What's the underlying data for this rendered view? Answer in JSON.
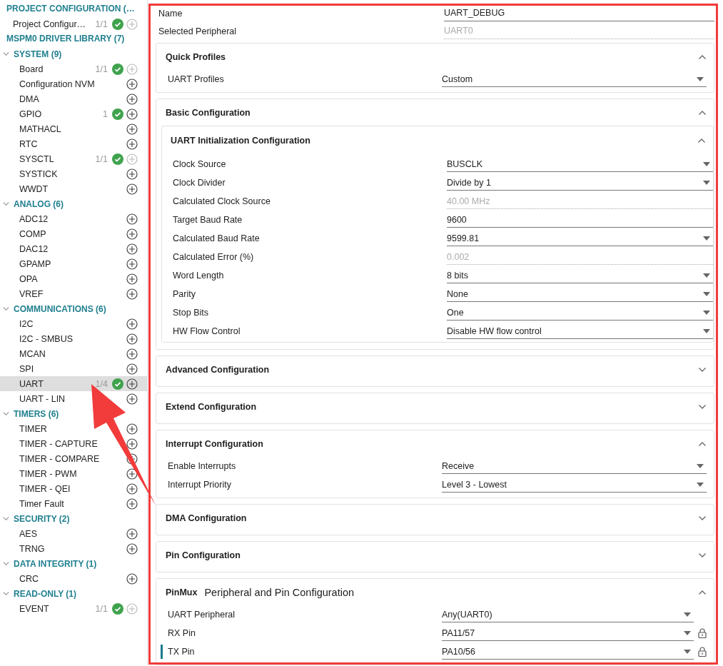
{
  "sidebar": {
    "groups": [
      {
        "label": "PROJECT CONFIGURATION (…",
        "items": [
          {
            "label": "Project Configur…",
            "count": "1/1",
            "configured": true,
            "can_add": false,
            "selected": false
          }
        ]
      },
      {
        "label": "MSPM0 DRIVER LIBRARY (7)",
        "categories": [
          {
            "label": "SYSTEM (9)",
            "expanded": true,
            "items": [
              {
                "label": "Board",
                "count": "1/1",
                "configured": true,
                "can_add": false,
                "selected": false
              },
              {
                "label": "Configuration NVM",
                "configured": false,
                "can_add": true,
                "selected": false
              },
              {
                "label": "DMA",
                "configured": false,
                "can_add": true,
                "selected": false
              },
              {
                "label": "GPIO",
                "count": "1",
                "configured": true,
                "can_add": true,
                "selected": false
              },
              {
                "label": "MATHACL",
                "configured": false,
                "can_add": true,
                "selected": false
              },
              {
                "label": "RTC",
                "configured": false,
                "can_add": true,
                "selected": false
              },
              {
                "label": "SYSCTL",
                "count": "1/1",
                "configured": true,
                "can_add": false,
                "selected": false
              },
              {
                "label": "SYSTICK",
                "configured": false,
                "can_add": true,
                "selected": false
              },
              {
                "label": "WWDT",
                "configured": false,
                "can_add": true,
                "selected": false
              }
            ]
          },
          {
            "label": "ANALOG (6)",
            "expanded": true,
            "items": [
              {
                "label": "ADC12",
                "configured": false,
                "can_add": true,
                "selected": false
              },
              {
                "label": "COMP",
                "configured": false,
                "can_add": true,
                "selected": false
              },
              {
                "label": "DAC12",
                "configured": false,
                "can_add": true,
                "selected": false
              },
              {
                "label": "GPAMP",
                "configured": false,
                "can_add": true,
                "selected": false
              },
              {
                "label": "OPA",
                "configured": false,
                "can_add": true,
                "selected": false
              },
              {
                "label": "VREF",
                "configured": false,
                "can_add": true,
                "selected": false
              }
            ]
          },
          {
            "label": "COMMUNICATIONS (6)",
            "expanded": true,
            "items": [
              {
                "label": "I2C",
                "configured": false,
                "can_add": true,
                "selected": false
              },
              {
                "label": "I2C - SMBUS",
                "configured": false,
                "can_add": true,
                "selected": false
              },
              {
                "label": "MCAN",
                "configured": false,
                "can_add": true,
                "selected": false
              },
              {
                "label": "SPI",
                "configured": false,
                "can_add": true,
                "selected": false
              },
              {
                "label": "UART",
                "count": "1/4",
                "configured": true,
                "can_add": true,
                "selected": true
              },
              {
                "label": "UART - LIN",
                "configured": false,
                "can_add": true,
                "selected": false
              }
            ]
          },
          {
            "label": "TIMERS (6)",
            "expanded": true,
            "items": [
              {
                "label": "TIMER",
                "configured": false,
                "can_add": true,
                "selected": false
              },
              {
                "label": "TIMER - CAPTURE",
                "configured": false,
                "can_add": true,
                "selected": false
              },
              {
                "label": "TIMER - COMPARE",
                "configured": false,
                "can_add": true,
                "selected": false
              },
              {
                "label": "TIMER - PWM",
                "configured": false,
                "can_add": true,
                "selected": false
              },
              {
                "label": "TIMER - QEI",
                "configured": false,
                "can_add": true,
                "selected": false
              },
              {
                "label": "Timer Fault",
                "configured": false,
                "can_add": true,
                "selected": false
              }
            ]
          },
          {
            "label": "SECURITY (2)",
            "expanded": true,
            "items": [
              {
                "label": "AES",
                "configured": false,
                "can_add": true,
                "selected": false
              },
              {
                "label": "TRNG",
                "configured": false,
                "can_add": true,
                "selected": false
              }
            ]
          },
          {
            "label": "DATA INTEGRITY (1)",
            "expanded": true,
            "items": [
              {
                "label": "CRC",
                "configured": false,
                "can_add": true,
                "selected": false
              }
            ]
          },
          {
            "label": "READ-ONLY (1)",
            "expanded": true,
            "items": [
              {
                "label": "EVENT",
                "count": "1/1",
                "configured": true,
                "can_add": false,
                "selected": false
              }
            ]
          }
        ]
      }
    ]
  },
  "fields": [
    {
      "label": "Name",
      "kind": "text",
      "value": "UART_DEBUG"
    },
    {
      "label": "Selected Peripheral",
      "kind": "readonly",
      "value": "UART0"
    }
  ],
  "sections": [
    {
      "title": "Quick Profiles",
      "expanded": true,
      "rows": [
        {
          "label": "UART Profiles",
          "kind": "select",
          "value": "Custom"
        }
      ]
    },
    {
      "title": "Basic Configuration",
      "expanded": true,
      "subsections": [
        {
          "title": "UART Initialization Configuration",
          "expanded": true,
          "rows": [
            {
              "label": "Clock Source",
              "kind": "select",
              "value": "BUSCLK"
            },
            {
              "label": "Clock Divider",
              "kind": "select",
              "value": "Divide by 1"
            },
            {
              "label": "Calculated Clock Source",
              "kind": "readonly",
              "value": "40.00 MHz"
            },
            {
              "label": "Target Baud Rate",
              "kind": "text",
              "value": "9600"
            },
            {
              "label": "Calculated Baud Rate",
              "kind": "select",
              "value": "9599.81"
            },
            {
              "label": "Calculated Error (%)",
              "kind": "readonly",
              "value": "0.002"
            },
            {
              "label": "Word Length",
              "kind": "select",
              "value": "8 bits"
            },
            {
              "label": "Parity",
              "kind": "select",
              "value": "None"
            },
            {
              "label": "Stop Bits",
              "kind": "select",
              "value": "One"
            },
            {
              "label": "HW Flow Control",
              "kind": "select",
              "value": "Disable HW flow control"
            }
          ]
        }
      ]
    },
    {
      "title": "Advanced Configuration",
      "expanded": false
    },
    {
      "title": "Extend Configuration",
      "expanded": false
    },
    {
      "title": "Interrupt Configuration",
      "expanded": true,
      "rows": [
        {
          "label": "Enable Interrupts",
          "kind": "select",
          "value": "Receive"
        },
        {
          "label": "Interrupt Priority",
          "kind": "select",
          "value": "Level 3 - Lowest"
        }
      ]
    },
    {
      "title": "DMA Configuration",
      "expanded": false
    },
    {
      "title": "Pin Configuration",
      "expanded": false
    },
    {
      "tag": "PinMux",
      "title": "Peripheral and Pin Configuration",
      "expanded": true,
      "rows": [
        {
          "label": "UART Peripheral",
          "kind": "select",
          "value": "Any(UART0)",
          "locked": false,
          "flagged": false
        },
        {
          "label": "RX Pin",
          "kind": "select",
          "value": "PA11/57",
          "locked": true,
          "flagged": false
        },
        {
          "label": "TX Pin",
          "kind": "select",
          "value": "PA10/56",
          "locked": true,
          "flagged": true
        }
      ]
    }
  ]
}
